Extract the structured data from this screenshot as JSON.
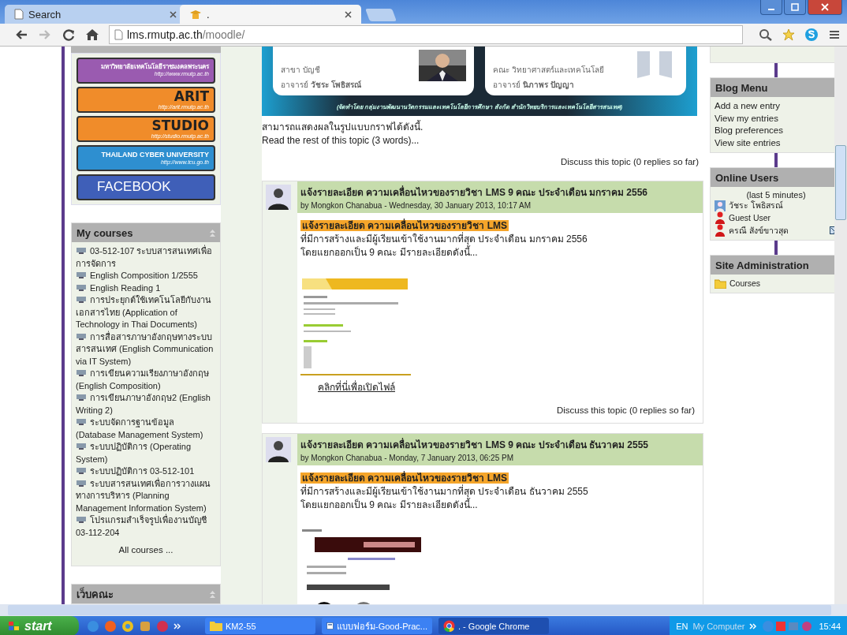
{
  "browser": {
    "tabs": [
      {
        "title": "Search",
        "selected": false
      },
      {
        "title": ".",
        "selected": true
      }
    ],
    "url_host": "lms.rmutp.ac.th",
    "url_path": "/moodle/"
  },
  "left_column": {
    "banners": [
      {
        "title": "มหาวิทยาลัยเทคโนโลยีราชมงคลพระนคร",
        "url": "http://www.rmutp.ac.th",
        "color": "#9a5bb0"
      },
      {
        "title": "ARIT",
        "url": "http://arit.rmutp.ac.th",
        "color": "#f08c2a"
      },
      {
        "title": "STUDIO",
        "url": "http://studio.rmutp.ac.th",
        "color": "#f08c2a"
      },
      {
        "title": "THAILAND CYBER UNIVERSITY",
        "url": "http://www.tcu.go.th",
        "color": "#2e8fd0"
      },
      {
        "title": "FACEBOOK",
        "color": "#3f5fb8"
      }
    ],
    "my_courses": {
      "title": "My courses",
      "items": [
        "03-512-107 ระบบสารสนเทศเพื่อการจัดการ",
        "English Composition 1/2555",
        "English Reading 1",
        "การประยุกต์ใช้เทคโนโลยีกับงานเอกสารไทย (Application of Technology in Thai Documents)",
        "การสื่อสารภาษาอังกฤษทางระบบสารสนเทศ (English Communication via IT System)",
        "การเขียนความเรียงภาษาอังกฤษ (English Composition)",
        "การเขียนภาษาอังกฤษ2 (English Writing 2)",
        "ระบบจัดการฐานข้อมูล (Database Management System)",
        "ระบบปฏิบัติการ (Operating System)",
        "ระบบปฏิบัติการ 03-512-101",
        "ระบบสารสนเทศเพื่อการวางแผนทางการบริหาร (Planning Management Information System)",
        "โปรแกรมสำเร็จรูปเพื่องานบัญชี 03-112-204"
      ],
      "footer": "All courses ..."
    },
    "next_block": {
      "title": "เว็บคณะ"
    }
  },
  "center": {
    "banner": {
      "left_dept": "สาขา บัญชี",
      "left_teacher": "อาจารย์ **วัชระ โพธิสรณ์**",
      "right_dept": "คณะ วิทยาศาสตร์และเทคโนโลยี",
      "right_teacher": "อาจารย์ **นิภาพร ปัญญา**",
      "footer": "(จัดทำโดย กลุ่มงานพัฒนานวัตกรรมและเทคโนโลยีการศึกษา สังกัด สำนักวิทยบริการและเทคโนโลยีสารสนเทศ)"
    },
    "intro": {
      "text": "สามารถแสดงผลในรูปแบบกราฟได้ดังนี้.",
      "read_more": "Read the rest of this topic (3 words)...",
      "discuss": "Discuss this topic (0 replies so far)"
    },
    "posts": [
      {
        "title": "แจ้งรายละเอียด ความเคลื่อนไหวของรายวิชา LMS 9 คณะ ประจำเดือน มกราคม 2556",
        "byline": "by Mongkon Chanabua - Wednesday, 30 January 2013, 10:17 AM",
        "highlight": "แจ้งรายละเอียด ความเคลื่อนไหวของรายวิชา LMS",
        "lines": [
          "ที่มีการสร้างและมีผู้เรียนเข้าใช้งานมากที่สุด ประจำเดือน มกราคม 2556",
          "โดยแยกออกเป็น 9 คณะ มีรายละเอียดดังนี้..."
        ],
        "attachment": "คลิกที่นี่เพื่อเปิดไฟล์",
        "discuss": "Discuss this topic (0 replies so far)"
      },
      {
        "title": "แจ้งรายละเอียด ความเคลื่อนไหวของรายวิชา LMS 9 คณะ ประจำเดือน ธันวาคม 2555",
        "byline": "by Mongkon Chanabua - Monday, 7 January 2013, 06:25 PM",
        "highlight": "แจ้งรายละเอียด ความเคลื่อนไหวของรายวิชา LMS",
        "lines": [
          "ที่มีการสร้างและมีผู้เรียนเข้าใช้งานมากที่สุด ประจำเดือน ธันวาคม 2555",
          "โดยแยกออกเป็น 9 คณะ มีรายละเอียดดังนี้..."
        ]
      }
    ]
  },
  "right_column": {
    "blog_menu": {
      "title": "Blog Menu",
      "items": [
        "Add a new entry",
        "View my entries",
        "Blog preferences",
        "View site entries"
      ]
    },
    "online_users": {
      "title": "Online Users",
      "subtitle": "(last 5 minutes)",
      "users": [
        {
          "name": "วัชระ โพธิสรณ์"
        },
        {
          "name": "Guest User",
          "kind": "guest"
        },
        {
          "name": "ครณี สังข์ขาวสุด",
          "kind": "guest"
        }
      ]
    },
    "site_admin": {
      "title": "Site Administration",
      "items": [
        "Courses"
      ]
    }
  },
  "taskbar": {
    "start": "start",
    "items": [
      {
        "label": "KM2-55",
        "kind": "folder",
        "selected": false
      },
      {
        "label": "แบบฟอร์ม-Good-Prac...",
        "kind": "document",
        "selected": false
      },
      {
        "label": ". - Google Chrome",
        "kind": "browser",
        "selected": true
      }
    ],
    "language": "EN",
    "tray_label": "My Computer",
    "time": "15:44"
  }
}
